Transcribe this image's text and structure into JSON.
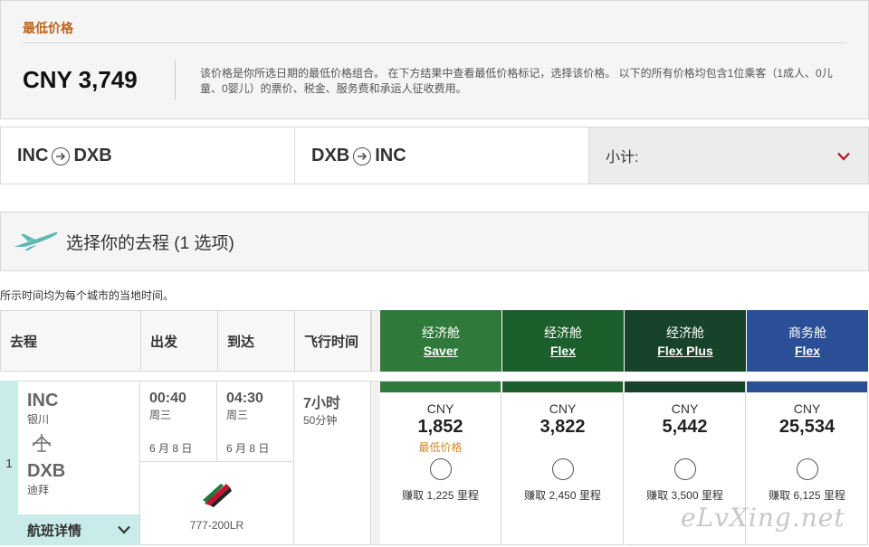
{
  "lowest": {
    "title": "最低价格",
    "price": "CNY 3,749",
    "note": "该价格是你所选日期的最低价格组合。 在下方结果中查看最低价格标记，选择该价格。 以下的所有价格均包含1位乘客（1成人、0儿童、0婴儿）的票价、税金、服务费和承运人征收费用。"
  },
  "routes": {
    "outbound": {
      "from": "INC",
      "to": "DXB"
    },
    "inbound": {
      "from": "DXB",
      "to": "INC"
    },
    "subtotal_label": "小计:"
  },
  "select": {
    "title": "选择你的去程 (1 选项)",
    "tz_note": "所示时间均为每个城市的当地时间。"
  },
  "table": {
    "headers": {
      "route": "去程",
      "depart": "出发",
      "arrive": "到达",
      "duration": "飞行时间"
    },
    "fares": [
      {
        "cabin": "经济舱",
        "name": "Saver",
        "color": "#2f7a3a",
        "currency": "CNY",
        "amount": "1,852",
        "label": "最低价格",
        "earn": "赚取 1,225 里程"
      },
      {
        "cabin": "经济舱",
        "name": "Flex",
        "color": "#1d5f2c",
        "currency": "CNY",
        "amount": "3,822",
        "label": "",
        "earn": "赚取 2,450 里程"
      },
      {
        "cabin": "经济舱",
        "name": "Flex Plus",
        "color": "#17432a",
        "currency": "CNY",
        "amount": "5,442",
        "label": "",
        "earn": "赚取 3,500 里程"
      },
      {
        "cabin": "商务舱",
        "name": "Flex",
        "color": "#2a4f96",
        "currency": "CNY",
        "amount": "25,534",
        "label": "",
        "earn": "赚取 6,125 里程"
      }
    ],
    "row": {
      "index": "1",
      "origin_code": "INC",
      "origin_city": "银川",
      "dest_code": "DXB",
      "dest_city": "迪拜",
      "details": "航班详情",
      "depart_time": "00:40",
      "depart_day": "周三",
      "depart_date": "6 月 8 日",
      "arrive_time": "04:30",
      "arrive_day": "周三",
      "arrive_date": "6 月 8 日",
      "duration_h": "7小时",
      "duration_m": "50分钟",
      "aircraft": "777-200LR"
    }
  },
  "watermark": "eLvXing.net"
}
